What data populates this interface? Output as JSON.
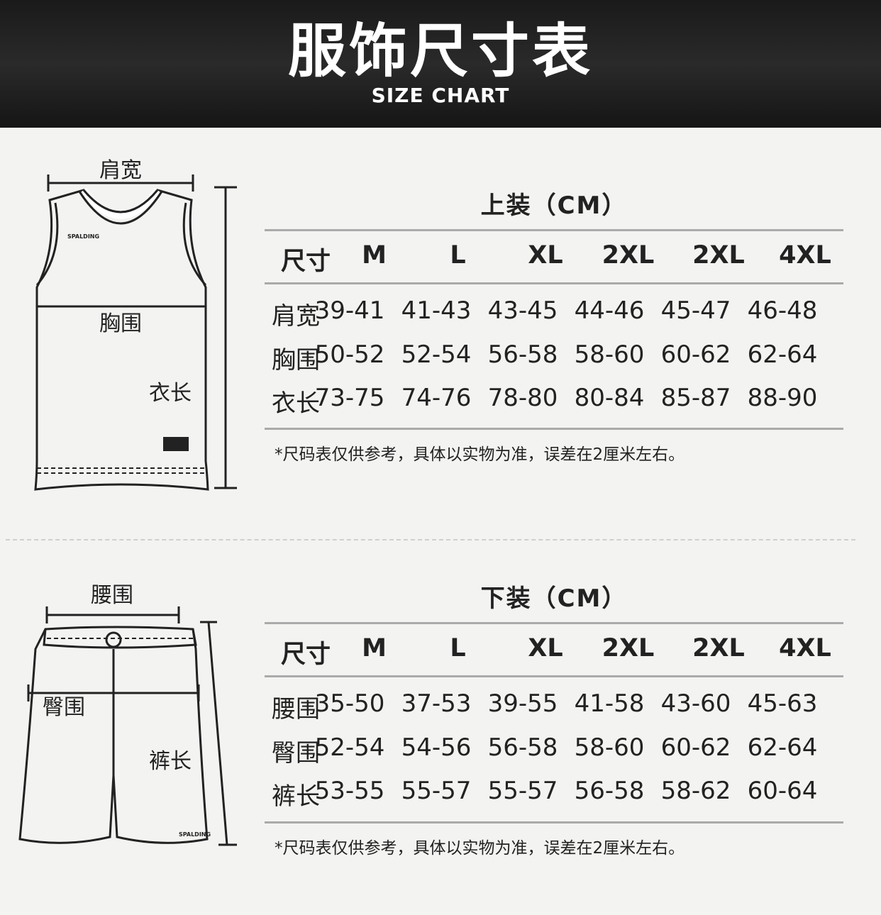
{
  "header": {
    "title": "服饰尺寸表",
    "subtitle": "SIZE CHART"
  },
  "top": {
    "labels": {
      "shoulder": "肩宽",
      "chest": "胸围",
      "length": "衣长"
    },
    "brand": "SPALDING",
    "table": {
      "title": "上装（CM）",
      "columns": [
        "尺寸",
        "M",
        "L",
        "XL",
        "2XL",
        "2XL",
        "4XL"
      ],
      "rows": [
        {
          "label": "肩宽",
          "values": [
            "39-41",
            "41-43",
            "43-45",
            "44-46",
            "45-47",
            "46-48"
          ]
        },
        {
          "label": "胸围",
          "values": [
            "50-52",
            "52-54",
            "56-58",
            "58-60",
            "60-62",
            "62-64"
          ]
        },
        {
          "label": "衣长",
          "values": [
            "73-75",
            "74-76",
            "78-80",
            "80-84",
            "85-87",
            "88-90"
          ]
        }
      ],
      "note": "*尺码表仅供参考，具体以实物为准，误差在2厘米左右。"
    }
  },
  "bottom": {
    "labels": {
      "waist": "腰围",
      "hip": "臀围",
      "length": "裤长"
    },
    "brand": "SPALDING",
    "table": {
      "title": "下装（CM）",
      "columns": [
        "尺寸",
        "M",
        "L",
        "XL",
        "2XL",
        "2XL",
        "4XL"
      ],
      "rows": [
        {
          "label": "腰围",
          "values": [
            "35-50",
            "37-53",
            "39-55",
            "41-58",
            "43-60",
            "45-63"
          ]
        },
        {
          "label": "臀围",
          "values": [
            "52-54",
            "54-56",
            "56-58",
            "58-60",
            "60-62",
            "62-64"
          ]
        },
        {
          "label": "裤长",
          "values": [
            "53-55",
            "55-57",
            "55-57",
            "56-58",
            "58-62",
            "60-64"
          ]
        }
      ],
      "note": "*尺码表仅供参考，具体以实物为准，误差在2厘米左右。"
    }
  }
}
